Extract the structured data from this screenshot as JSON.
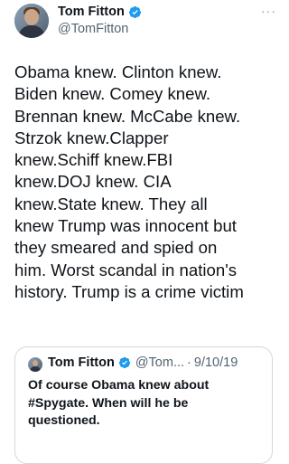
{
  "tweet": {
    "author_name": "Tom Fitton",
    "author_handle": "@TomFitton",
    "more_label": "···",
    "text": "Obama knew. Clinton knew.\nBiden knew. Comey knew.\nBrennan knew. McCabe knew.\nStrzok knew.Clapper\nknew.Schiff knew.FBI\nknew.DOJ knew. CIA\nknew.State knew. They all\nknew Trump was innocent but\nthey smeared and spied on\nhim. Worst scandal in nation's\nhistory. Trump is a crime victim"
  },
  "quote": {
    "author_name": "Tom Fitton",
    "author_handle": "@Tom...",
    "separator": "·",
    "date": "9/10/19",
    "text": "Of course Obama knew about\n#Spygate. When will he be\nquestioned."
  },
  "colors": {
    "verified_blue": "#1d9bf0",
    "text_primary": "#0f1419",
    "text_secondary": "#536471",
    "border": "#cfd9de"
  },
  "icons": {
    "verified": "verified-badge-icon",
    "more": "more-options-icon"
  }
}
